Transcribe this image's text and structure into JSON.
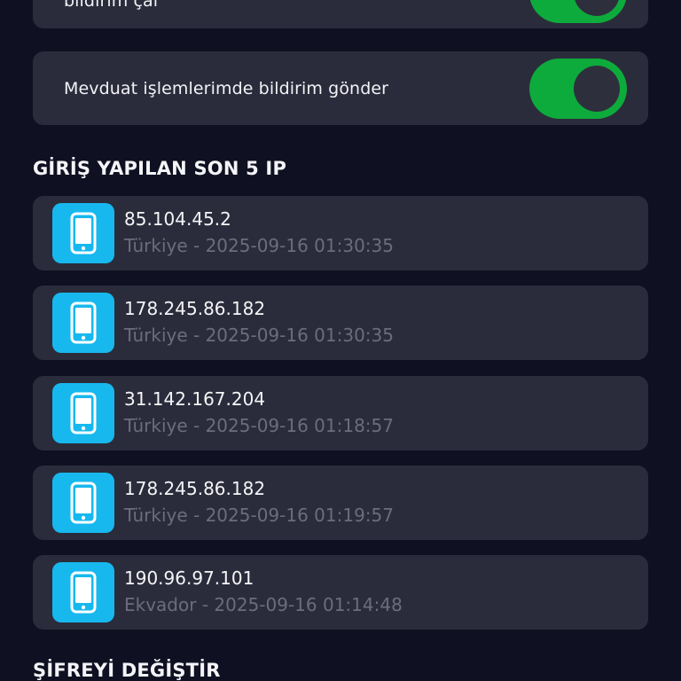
{
  "notifications": {
    "items": [
      {
        "label": "bildirim çal",
        "enabled": true
      },
      {
        "label": "Mevduat işlemlerimde bildirim gönder",
        "enabled": true
      }
    ]
  },
  "login_history": {
    "title": "GİRİŞ YAPILAN SON 5 IP",
    "items": [
      {
        "ip": "85.104.45.2",
        "meta": "Türkiye - 2025-09-16 01:30:35"
      },
      {
        "ip": "178.245.86.182",
        "meta": "Türkiye - 2025-09-16 01:30:35"
      },
      {
        "ip": "31.142.167.204",
        "meta": "Türkiye - 2025-09-16 01:18:57"
      },
      {
        "ip": "178.245.86.182",
        "meta": "Türkiye - 2025-09-16 01:19:57"
      },
      {
        "ip": "190.96.97.101",
        "meta": "Ekvador - 2025-09-16 01:14:48"
      }
    ]
  },
  "password": {
    "title": "ŞİFREYİ DEĞİŞTİR"
  },
  "colors": {
    "background": "#0f1021",
    "card": "#2b2c3b",
    "toggle_on": "#0dab3b",
    "device_icon_bg": "#17b8ee",
    "secondary_text": "#6b6c7c"
  },
  "icons": {
    "device": "smartphone-icon"
  }
}
